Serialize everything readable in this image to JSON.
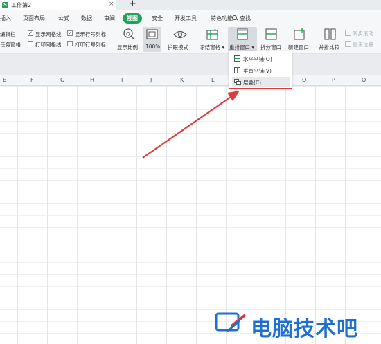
{
  "titlebar": {
    "doc_title": "工作簿2",
    "close_glyph": "×",
    "new_tab_glyph": "+",
    "app_icon_letter": "S"
  },
  "menu": {
    "items": [
      "插入",
      "页面布局",
      "公式",
      "数据",
      "审阅",
      "视图",
      "安全",
      "开发工具",
      "特色功能"
    ],
    "active": "视图",
    "search_label": "查找"
  },
  "ribbon": {
    "left_labels": {
      "edit_bar": "编辑栏",
      "task_pane": "任务窗格"
    },
    "checks": [
      {
        "label": "显示网格线",
        "checked": true
      },
      {
        "label": "显示行号列标",
        "checked": true
      },
      {
        "label": "打印网格线",
        "checked": false
      },
      {
        "label": "打印行号列标",
        "checked": false
      }
    ],
    "buttons": {
      "zoom": "显示比例",
      "zoom_100": "100%",
      "eye_protect": "护眼模式",
      "freeze": "冻结窗格 ▾",
      "arrange": "重排窗口 ▾",
      "split": "拆分窗口",
      "new_window": "新建窗口",
      "side_by_side": "并排比较",
      "sync_scroll": "同步滚动",
      "reset_position": "重设位置"
    }
  },
  "columns": [
    "E",
    "F",
    "G",
    "H",
    "I",
    "J",
    "K",
    "L",
    "O",
    "P",
    "Q"
  ],
  "dropdown": {
    "items": [
      {
        "label": "水平平铺(O)",
        "icon": "horizontal-tile-icon"
      },
      {
        "label": "垂直平铺(V)",
        "icon": "vertical-tile-icon"
      },
      {
        "label": "层叠(C)",
        "icon": "cascade-icon"
      }
    ],
    "highlight_color": "#e0393a"
  },
  "watermark": {
    "text": "电脑技术吧",
    "color": "#1d6fd1"
  },
  "colors": {
    "accent": "#1fa35a",
    "arrow": "#e0393a"
  }
}
